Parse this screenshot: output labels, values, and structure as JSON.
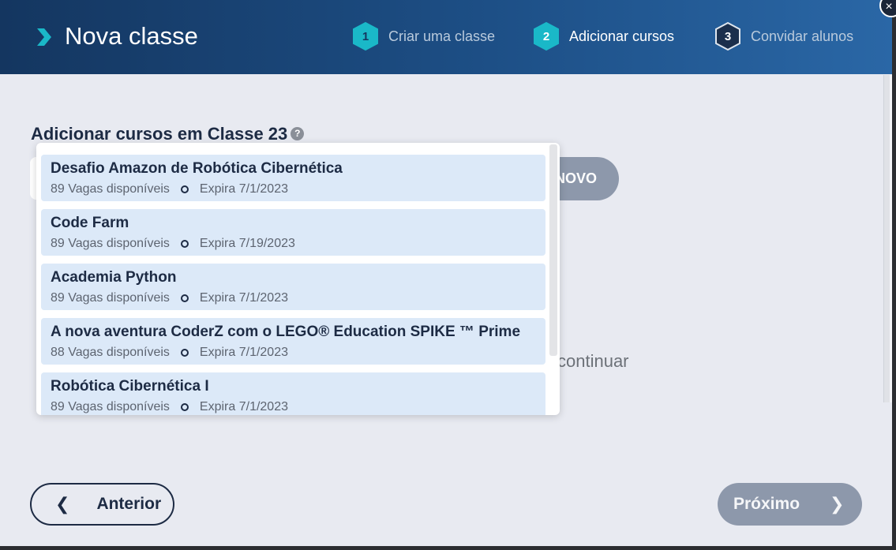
{
  "header": {
    "title": "Nova classe",
    "steps": [
      {
        "number": "1",
        "label": "Criar uma classe"
      },
      {
        "number": "2",
        "label": "Adicionar cursos"
      },
      {
        "number": "3",
        "label": "Convidar alunos"
      }
    ]
  },
  "close": {
    "label": "×"
  },
  "main": {
    "section_title": "Adicionar cursos em Classe 23",
    "help_icon": "?",
    "new_button_label": "NOVO",
    "continue_text": "continuar"
  },
  "dropdown": {
    "items": [
      {
        "name": "Desafio Amazon de Robótica Cibernética",
        "seats": "89 Vagas disponíveis",
        "expires": "Expira 7/1/2023"
      },
      {
        "name": "Code Farm",
        "seats": "89 Vagas disponíveis",
        "expires": "Expira 7/19/2023"
      },
      {
        "name": "Academia Python",
        "seats": "89 Vagas disponíveis",
        "expires": "Expira 7/1/2023"
      },
      {
        "name": "A nova aventura CoderZ com o LEGO® Education SPIKE ™ Prime",
        "seats": "88 Vagas disponíveis",
        "expires": "Expira 7/1/2023"
      },
      {
        "name": "Robótica Cibernética I",
        "seats": "89 Vagas disponíveis",
        "expires": "Expira 7/1/2023"
      }
    ]
  },
  "footer": {
    "prev_label": "Anterior",
    "next_label": "Próximo"
  },
  "colors": {
    "accent": "#1ab8c8",
    "header_dark": "#143660",
    "text_dark": "#1d2b44",
    "item_bg": "#dce9f8",
    "disabled_button": "#8d98ab"
  }
}
